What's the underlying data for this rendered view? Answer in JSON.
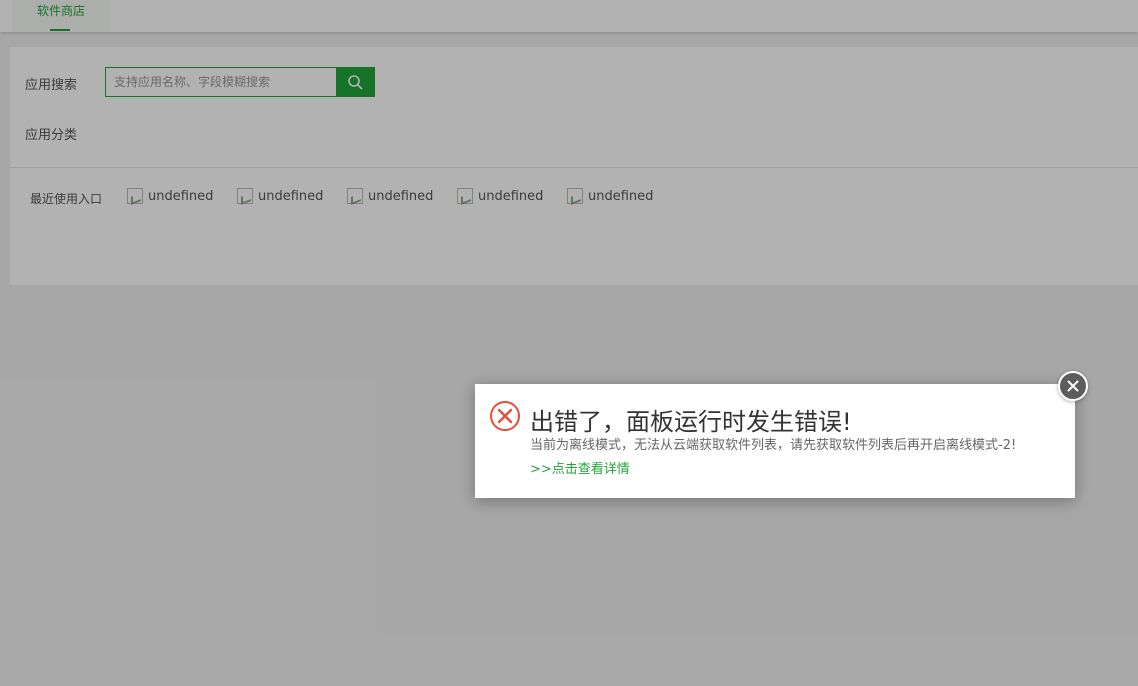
{
  "tabs": [
    {
      "label": "软件商店",
      "active": true
    }
  ],
  "search": {
    "label": "应用搜索",
    "placeholder": "支持应用名称、字段模糊搜索",
    "value": ""
  },
  "category": {
    "label": "应用分类"
  },
  "recent": {
    "label": "最近使用入口",
    "items": [
      "undefined",
      "undefined",
      "undefined",
      "undefined",
      "undefined"
    ]
  },
  "dialog": {
    "title": "出错了，面板运行时发生错误!",
    "message": "当前为离线模式，无法从云端获取软件列表，请先获取软件列表后再开启离线模式-2!",
    "link": ">>点击查看详情"
  },
  "colors": {
    "accent": "#20a53a",
    "error": "#e74c3c"
  },
  "icons": {
    "search": "search-icon",
    "error": "error-circle-icon",
    "close": "close-icon",
    "broken_image": "broken-image-icon"
  }
}
